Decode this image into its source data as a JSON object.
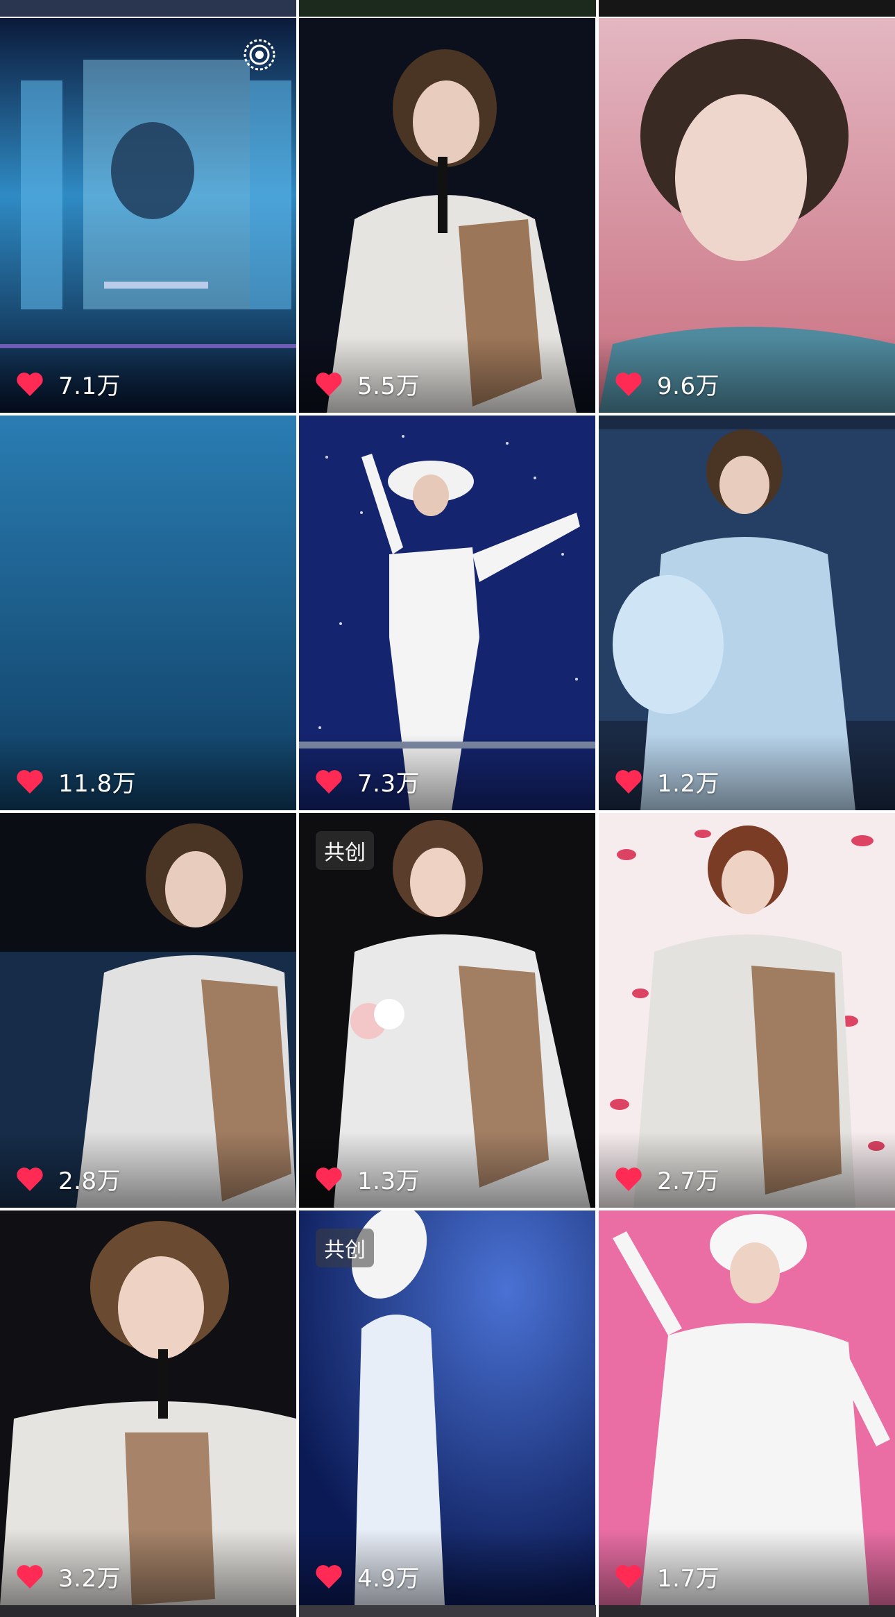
{
  "colors": {
    "heart": "#ff2b54",
    "text": "#ffffff",
    "background": "#ffffff"
  },
  "tiles": [
    {
      "likes": "7.1万",
      "badge": null,
      "icon": "live-icon",
      "scene": "blue-stage"
    },
    {
      "likes": "5.5万",
      "badge": null,
      "scene": "white-suit-mic"
    },
    {
      "likes": "9.6万",
      "badge": null,
      "scene": "pink-closeup"
    },
    {
      "likes": "11.8万",
      "badge": null,
      "scene": "blue-gradient"
    },
    {
      "likes": "7.3万",
      "badge": null,
      "scene": "starry-hat"
    },
    {
      "likes": "1.2万",
      "badge": null,
      "scene": "feather-blue"
    },
    {
      "likes": "2.8万",
      "badge": null,
      "scene": "white-suit-dark"
    },
    {
      "likes": "1.3万",
      "badge": "共创",
      "scene": "bouquet-cape"
    },
    {
      "likes": "2.7万",
      "badge": null,
      "scene": "rose-petals"
    },
    {
      "likes": "3.2万",
      "badge": null,
      "scene": "closeup-mic"
    },
    {
      "likes": "4.9万",
      "badge": "共创",
      "scene": "hat-blue-light"
    },
    {
      "likes": "1.7万",
      "badge": null,
      "scene": "pink-dance"
    }
  ]
}
